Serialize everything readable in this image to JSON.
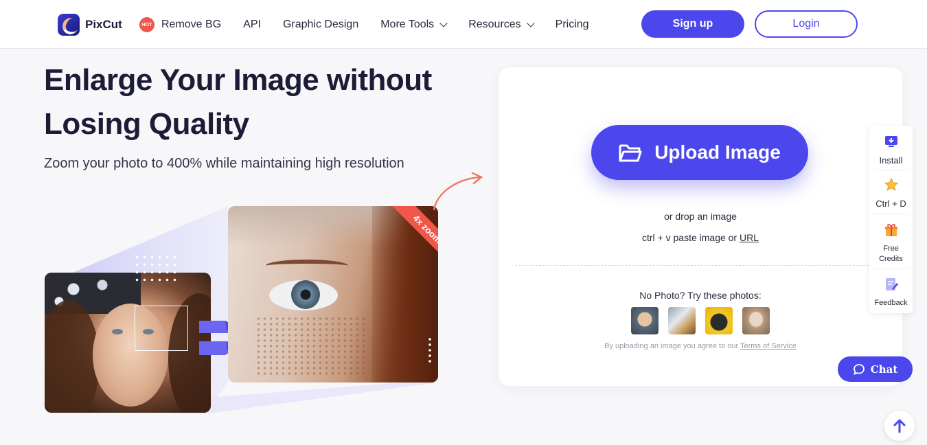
{
  "brand": {
    "name": "PixCut"
  },
  "nav": {
    "hot_badge": "HOT",
    "remove_bg": "Remove BG",
    "api": "API",
    "graphic_design": "Graphic Design",
    "more_tools": "More Tools",
    "resources": "Resources",
    "pricing": "Pricing"
  },
  "auth": {
    "signup": "Sign up",
    "login": "Login"
  },
  "hero": {
    "title": "Enlarge Your Image without Losing Quality",
    "subtitle": "Zoom your photo to 400% while maintaining high resolution",
    "zoom_label": "4x zoom"
  },
  "upload": {
    "button": "Upload Image",
    "drop": "or drop an image",
    "paste_prefix": "ctrl + v paste image or ",
    "paste_link": "URL",
    "try_title": "No Photo? Try these photos:",
    "terms_prefix": "By uploading an image you agree to our ",
    "terms_link": "Terms of Service"
  },
  "sidebar": {
    "install": "Install",
    "bookmark": "Ctrl + D",
    "free_credits_1": "Free",
    "free_credits_2": "Credits",
    "feedback": "Feedback"
  },
  "chat": {
    "label": "Chat"
  },
  "colors": {
    "accent": "#4b47ec",
    "hot": "#f0564a"
  }
}
